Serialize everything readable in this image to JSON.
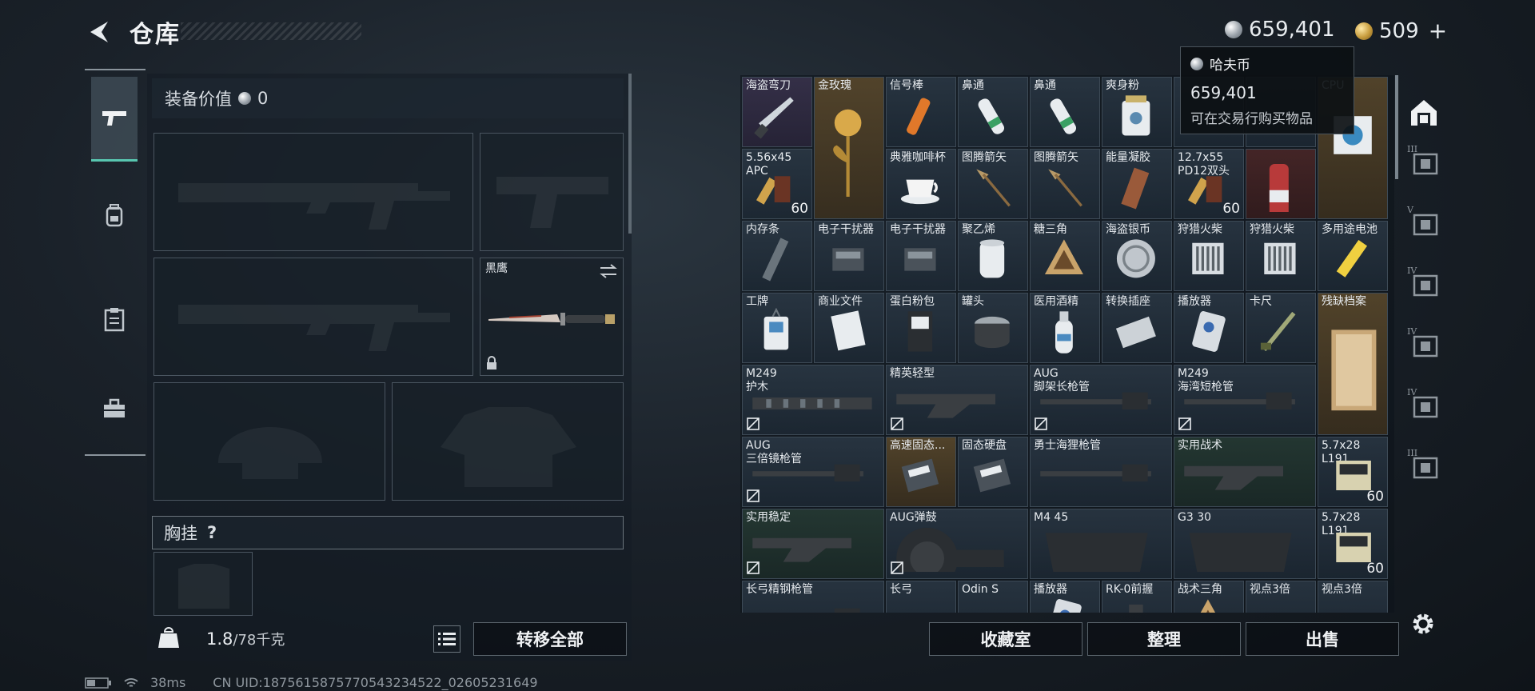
{
  "header": {
    "title": "仓库",
    "currency_haf": "659,401",
    "currency_gold": "509",
    "plus": "+"
  },
  "equipment": {
    "value_label": "装备价值",
    "value": "0",
    "knife_label": "黑鹰",
    "chest_rig_label": "胸挂",
    "chest_help": "?",
    "weight_current": "1.8",
    "weight_max": "/78千克",
    "transfer_all": "转移全部"
  },
  "tooltip": {
    "name": "哈夫币",
    "value": "659,401",
    "desc": "可在交易行购买物品"
  },
  "grid": {
    "items": [
      {
        "label": "海盗弯刀",
        "count": "",
        "tier": "purple",
        "icon": "knife-icon"
      },
      {
        "label": "金玫瑰",
        "count": "",
        "tier": "gold",
        "icon": "gold-rose-icon"
      },
      {
        "label": "信号棒",
        "count": "",
        "tier": "",
        "icon": "flare-icon"
      },
      {
        "label": "鼻通",
        "count": "",
        "tier": "",
        "icon": "inhaler-icon"
      },
      {
        "label": "鼻通",
        "count": "",
        "tier": "",
        "icon": "inhaler-icon"
      },
      {
        "label": "爽身粉",
        "count": "",
        "tier": "",
        "icon": "powder-can-icon"
      },
      {
        "label": "",
        "count": "",
        "tier": "",
        "icon": "hidden-item-icon"
      },
      {
        "label": "",
        "count": "",
        "tier": "",
        "icon": "hidden-item-icon"
      },
      {
        "label": "5.56x45\nAPC",
        "count": "60",
        "tier": "",
        "icon": "ammo-icon"
      },
      {
        "label": "典雅咖啡杯",
        "count": "",
        "tier": "",
        "icon": "coffee-cup-icon"
      },
      {
        "label": "图腾箭矢",
        "count": "",
        "tier": "",
        "icon": "arrow-icon"
      },
      {
        "label": "图腾箭矢",
        "count": "",
        "tier": "",
        "icon": "arrow-icon"
      },
      {
        "label": "能量凝胶",
        "count": "",
        "tier": "",
        "icon": "gel-icon"
      },
      {
        "label": "12.7x55\nPD12双头",
        "count": "60",
        "tier": "",
        "icon": "ammo-icon"
      },
      {
        "label": "",
        "count": "",
        "tier": "red",
        "icon": "spray-can-icon"
      },
      {
        "label": "CPU",
        "count": "",
        "tier": "gold",
        "icon": "cpu-icon"
      },
      {
        "label": "内存条",
        "count": "",
        "tier": "",
        "icon": "ram-icon"
      },
      {
        "label": "电子干扰器",
        "count": "",
        "tier": "",
        "icon": "jammer-icon"
      },
      {
        "label": "电子干扰器",
        "count": "",
        "tier": "",
        "icon": "jammer-icon"
      },
      {
        "label": "聚乙烯",
        "count": "",
        "tier": "",
        "icon": "roll-icon"
      },
      {
        "label": "糖三角",
        "count": "",
        "tier": "",
        "icon": "triangle-icon"
      },
      {
        "label": "海盗银币",
        "count": "",
        "tier": "",
        "icon": "coin-icon"
      },
      {
        "label": "狩猎火柴",
        "count": "",
        "tier": "",
        "icon": "matches-icon"
      },
      {
        "label": "狩猎火柴",
        "count": "",
        "tier": "",
        "icon": "matches-icon"
      },
      {
        "label": "多用途电池",
        "count": "",
        "tier": "",
        "icon": "battery-icon"
      },
      {
        "label": "工牌",
        "count": "",
        "tier": "",
        "icon": "badge-icon"
      },
      {
        "label": "商业文件",
        "count": "",
        "tier": "",
        "icon": "document-icon"
      },
      {
        "label": "蛋白粉包",
        "count": "",
        "tier": "",
        "icon": "protein-pack-icon"
      },
      {
        "label": "罐头",
        "count": "",
        "tier": "",
        "icon": "can-icon"
      },
      {
        "label": "医用酒精",
        "count": "",
        "tier": "",
        "icon": "bottle-icon"
      },
      {
        "label": "转换插座",
        "count": "",
        "tier": "",
        "icon": "socket-icon"
      },
      {
        "label": "播放器",
        "count": "",
        "tier": "",
        "icon": "player-icon"
      },
      {
        "label": "卡尺",
        "count": "",
        "tier": "",
        "icon": "caliper-icon"
      },
      {
        "label": "残缺档案",
        "count": "",
        "tier": "gold",
        "icon": "archive-icon"
      },
      {
        "label": "M249\n护木",
        "count": "",
        "tier": "",
        "icon": "handguard-icon"
      },
      {
        "label": "精英轻型",
        "count": "",
        "tier": "",
        "icon": "stock-icon"
      },
      {
        "label": "AUG\n脚架长枪管",
        "count": "",
        "tier": "",
        "icon": "barrel-icon"
      },
      {
        "label": "M249\n海湾短枪管",
        "count": "",
        "tier": "",
        "icon": "barrel-icon"
      },
      {
        "label": "AUG\n三倍镜枪管",
        "count": "",
        "tier": "",
        "icon": "barrel-icon"
      },
      {
        "label": "高速固态...",
        "count": "",
        "tier": "gold",
        "icon": "ssd-icon"
      },
      {
        "label": "固态硬盘",
        "count": "",
        "tier": "",
        "icon": "ssd-icon"
      },
      {
        "label": "勇士海狸枪管",
        "count": "",
        "tier": "",
        "icon": "barrel-icon"
      },
      {
        "label": "实用战术",
        "count": "",
        "tier": "green",
        "icon": "stock-icon"
      },
      {
        "label": "5.7x28\nL191",
        "count": "60",
        "tier": "",
        "icon": "ammo-box-icon"
      },
      {
        "label": "实用稳定",
        "count": "",
        "tier": "green",
        "icon": "stock-icon"
      },
      {
        "label": "AUG弹鼓",
        "count": "",
        "tier": "",
        "icon": "drum-mag-icon"
      },
      {
        "label": "M4 45",
        "count": "",
        "tier": "",
        "icon": "magazine-icon"
      },
      {
        "label": "G3 30",
        "count": "",
        "tier": "",
        "icon": "magazine-icon"
      },
      {
        "label": "5.7x28\nL191",
        "count": "60",
        "tier": "",
        "icon": "ammo-box-icon"
      },
      {
        "label": "长弓精钢枪管",
        "count": "",
        "tier": "",
        "icon": "barrel-icon"
      },
      {
        "label": "长弓",
        "count": "",
        "tier": "",
        "icon": "barrel-icon"
      },
      {
        "label": "Odin S",
        "count": "",
        "tier": "",
        "icon": "scope-icon"
      },
      {
        "label": "播放器",
        "count": "",
        "tier": "",
        "icon": "player-icon"
      },
      {
        "label": "RK-0前握",
        "count": "",
        "tier": "",
        "icon": "grip-icon"
      },
      {
        "label": "战术三角",
        "count": "",
        "tier": "",
        "icon": "triangle-icon"
      },
      {
        "label": "视点3倍",
        "count": "",
        "tier": "",
        "icon": "scope-icon"
      },
      {
        "label": "视点3倍",
        "count": "",
        "tier": "",
        "icon": "scope-icon"
      }
    ]
  },
  "right_rail": {
    "tiers": [
      "III",
      "V",
      "IV",
      "IV",
      "IV",
      "III"
    ]
  },
  "actions": {
    "collection": "收藏室",
    "sort": "整理",
    "sell": "出售"
  },
  "status": {
    "ping": "38ms",
    "uid": "CN UID:1875615875770543234522_02605231649"
  }
}
